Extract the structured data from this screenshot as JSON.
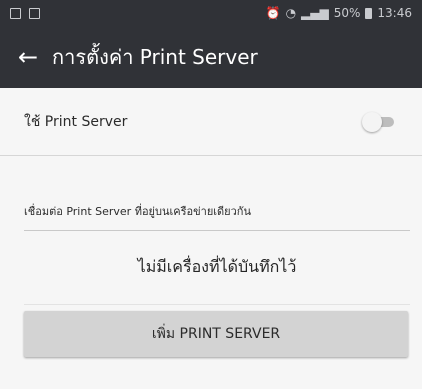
{
  "status_bar": {
    "signal_label": "50%",
    "time": "13:46"
  },
  "app_bar": {
    "back_icon": "arrow-left-icon",
    "title": "การตั้งค่า Print Server"
  },
  "settings": {
    "use_print_server_label": "ใช้ Print Server",
    "use_print_server_enabled": false
  },
  "section": {
    "label": "เชื่อมต่อ Print Server ที่อยู่บนเครือข่ายเดียวกัน"
  },
  "list": {
    "empty_text": "ไม่มีเครื่องที่ได้บันทึกไว้"
  },
  "actions": {
    "add_label": "เพิ่ม PRINT SERVER"
  }
}
